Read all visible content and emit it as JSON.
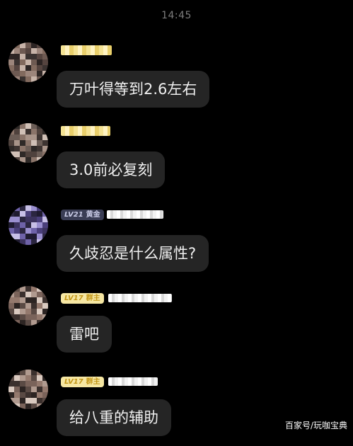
{
  "status": {
    "time": "14:45"
  },
  "messages": [
    {
      "sender": {
        "badge_level": "",
        "badge_rank": "",
        "badge_style": "hidden",
        "avatar_palette": [
          "#3a3230",
          "#6e5a52",
          "#9c857b",
          "#c7b3a8",
          "#55443f",
          "#826a5e",
          "#2d2524"
        ]
      },
      "text": "万叶得等到2.6左右"
    },
    {
      "sender": {
        "badge_level": "",
        "badge_rank": "",
        "badge_style": "hidden",
        "avatar_palette": [
          "#2e2927",
          "#6b5d56",
          "#a89489",
          "#d0c0b6",
          "#4f423d",
          "#8a7469",
          "#3d3431"
        ]
      },
      "text": "3.0前必复刻"
    },
    {
      "sender": {
        "badge_level": "LV21",
        "badge_rank": "黄金",
        "badge_style": "purple",
        "avatar_palette": [
          "#2b2640",
          "#4a3f7a",
          "#6e62a8",
          "#9a8fcf",
          "#3c335e",
          "#c7bfe6",
          "#1f1b30"
        ]
      },
      "text": "久歧忍是什么属性?"
    },
    {
      "sender": {
        "badge_level": "LV17",
        "badge_rank": "群主",
        "badge_style": "gold",
        "avatar_palette": [
          "#3b302d",
          "#7a635a",
          "#b09a8f",
          "#d9c9bf",
          "#5a4a44",
          "#94796d",
          "#2c2422"
        ]
      },
      "text": "雷吧"
    },
    {
      "sender": {
        "badge_level": "LV17",
        "badge_rank": "群主",
        "badge_style": "gold",
        "avatar_palette": [
          "#3b302d",
          "#7a635a",
          "#b09a8f",
          "#d9c9bf",
          "#5a4a44",
          "#94796d",
          "#2c2422"
        ]
      },
      "text": "给八重的辅助"
    }
  ],
  "watermark": "百家号/玩咖宝典"
}
